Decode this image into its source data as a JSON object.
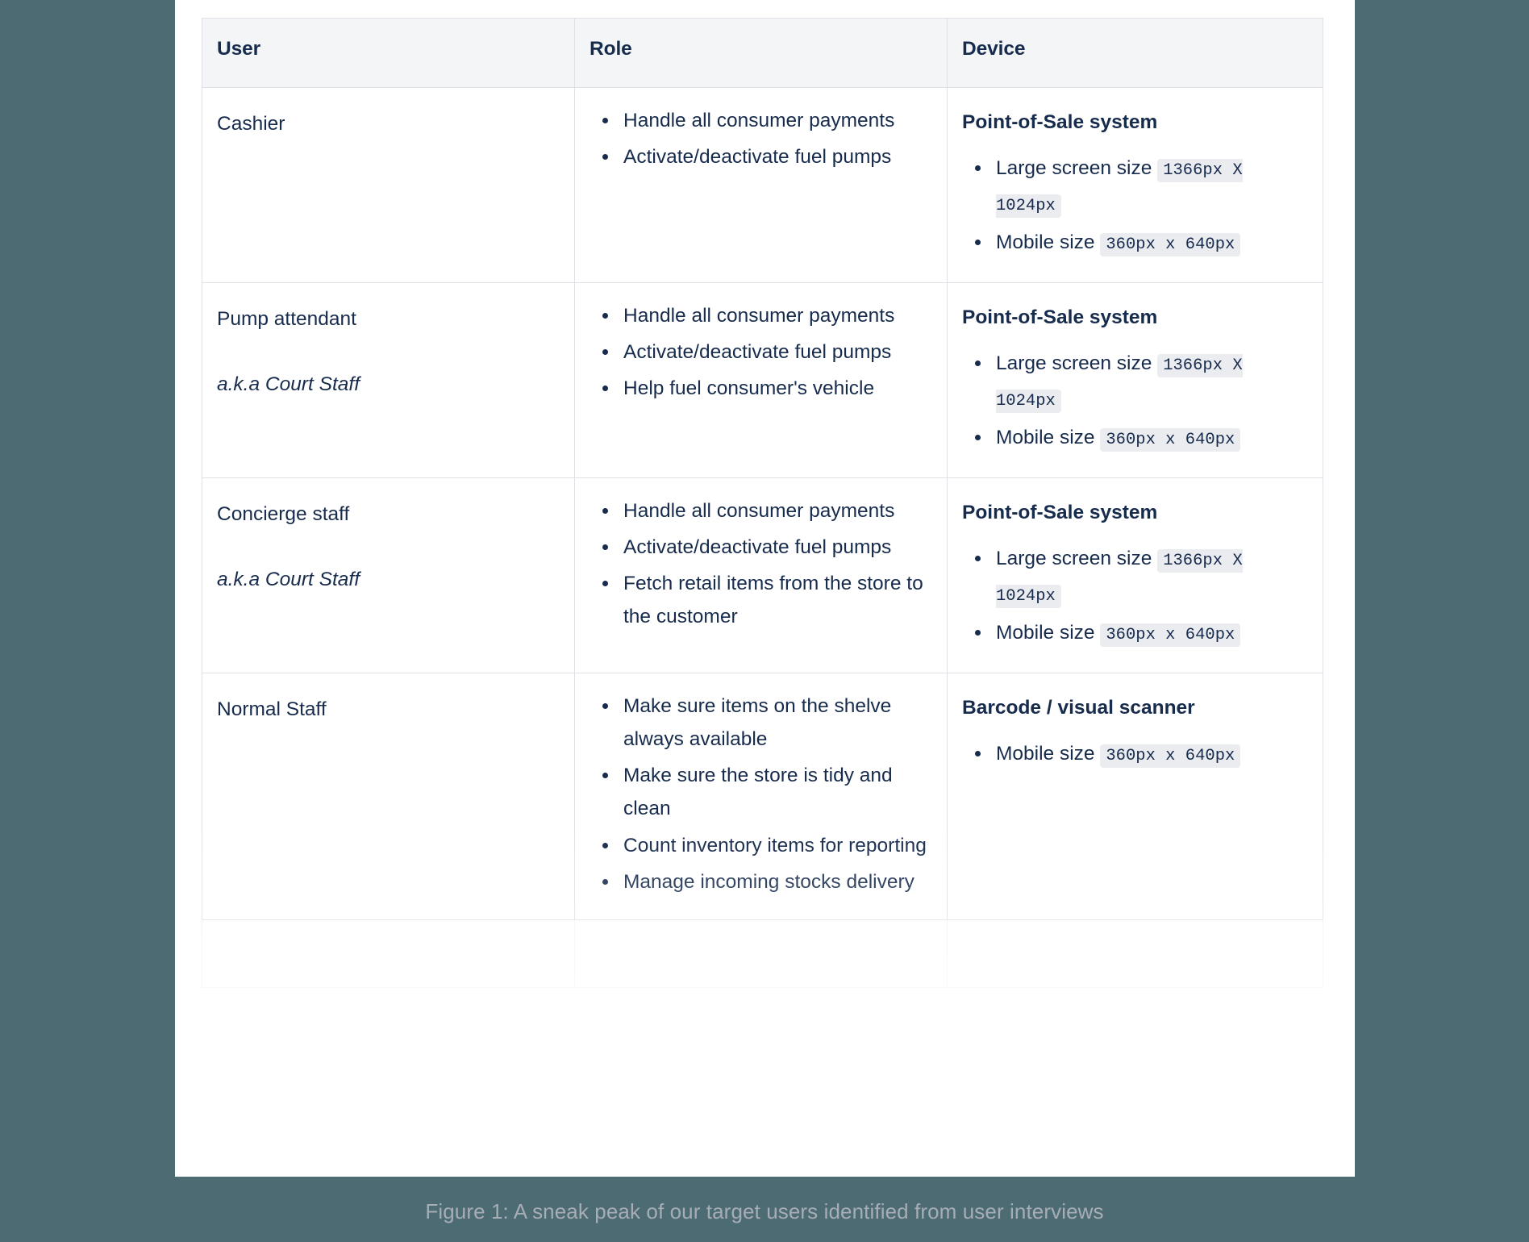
{
  "document": {
    "caption": "Figure 1: A sneak peak of our target users identified from user interviews"
  },
  "table": {
    "columns": [
      {
        "key": "user",
        "label": "User"
      },
      {
        "key": "role",
        "label": "Role"
      },
      {
        "key": "device",
        "label": "Device"
      }
    ],
    "rows": [
      {
        "user": {
          "name": "Cashier",
          "alias": ""
        },
        "role": [
          "Handle all consumer payments",
          "Activate/deactivate fuel pumps"
        ],
        "device": {
          "title": "Point-of-Sale system",
          "items": [
            {
              "label": "Large screen size",
              "value": "1366px X 1024px"
            },
            {
              "label": "Mobile size",
              "value": "360px x 640px"
            }
          ]
        }
      },
      {
        "user": {
          "name": "Pump attendant",
          "alias": "a.k.a Court Staff"
        },
        "role": [
          "Handle all consumer payments",
          "Activate/deactivate fuel pumps",
          "Help fuel consumer's vehicle"
        ],
        "device": {
          "title": "Point-of-Sale system",
          "items": [
            {
              "label": "Large screen size",
              "value": "1366px X 1024px"
            },
            {
              "label": "Mobile size",
              "value": "360px x 640px"
            }
          ]
        }
      },
      {
        "user": {
          "name": "Concierge staff",
          "alias": "a.k.a Court Staff"
        },
        "role": [
          "Handle all consumer payments",
          "Activate/deactivate fuel pumps",
          "Fetch retail items from the store to the customer"
        ],
        "device": {
          "title": "Point-of-Sale system",
          "items": [
            {
              "label": "Large screen size",
              "value": "1366px X 1024px"
            },
            {
              "label": "Mobile size",
              "value": "360px x 640px"
            }
          ]
        }
      },
      {
        "user": {
          "name": "Normal Staff",
          "alias": ""
        },
        "role": [
          "Make sure items on the shelve always available",
          "Make sure the store is tidy and clean",
          "Count inventory items for reporting",
          "Manage incoming stocks delivery"
        ],
        "device": {
          "title": "Barcode / visual scanner",
          "items": [
            {
              "label": "Mobile size",
              "value": "360px x 640px"
            }
          ]
        }
      }
    ]
  },
  "colors": {
    "page_background": "#4d6b73",
    "card_background": "#ffffff",
    "text": "#172b4d",
    "header_background": "#f4f5f7",
    "border": "#dfe1e6",
    "code_chip_background": "#ebecf0",
    "caption_text": "#a7adb5"
  }
}
